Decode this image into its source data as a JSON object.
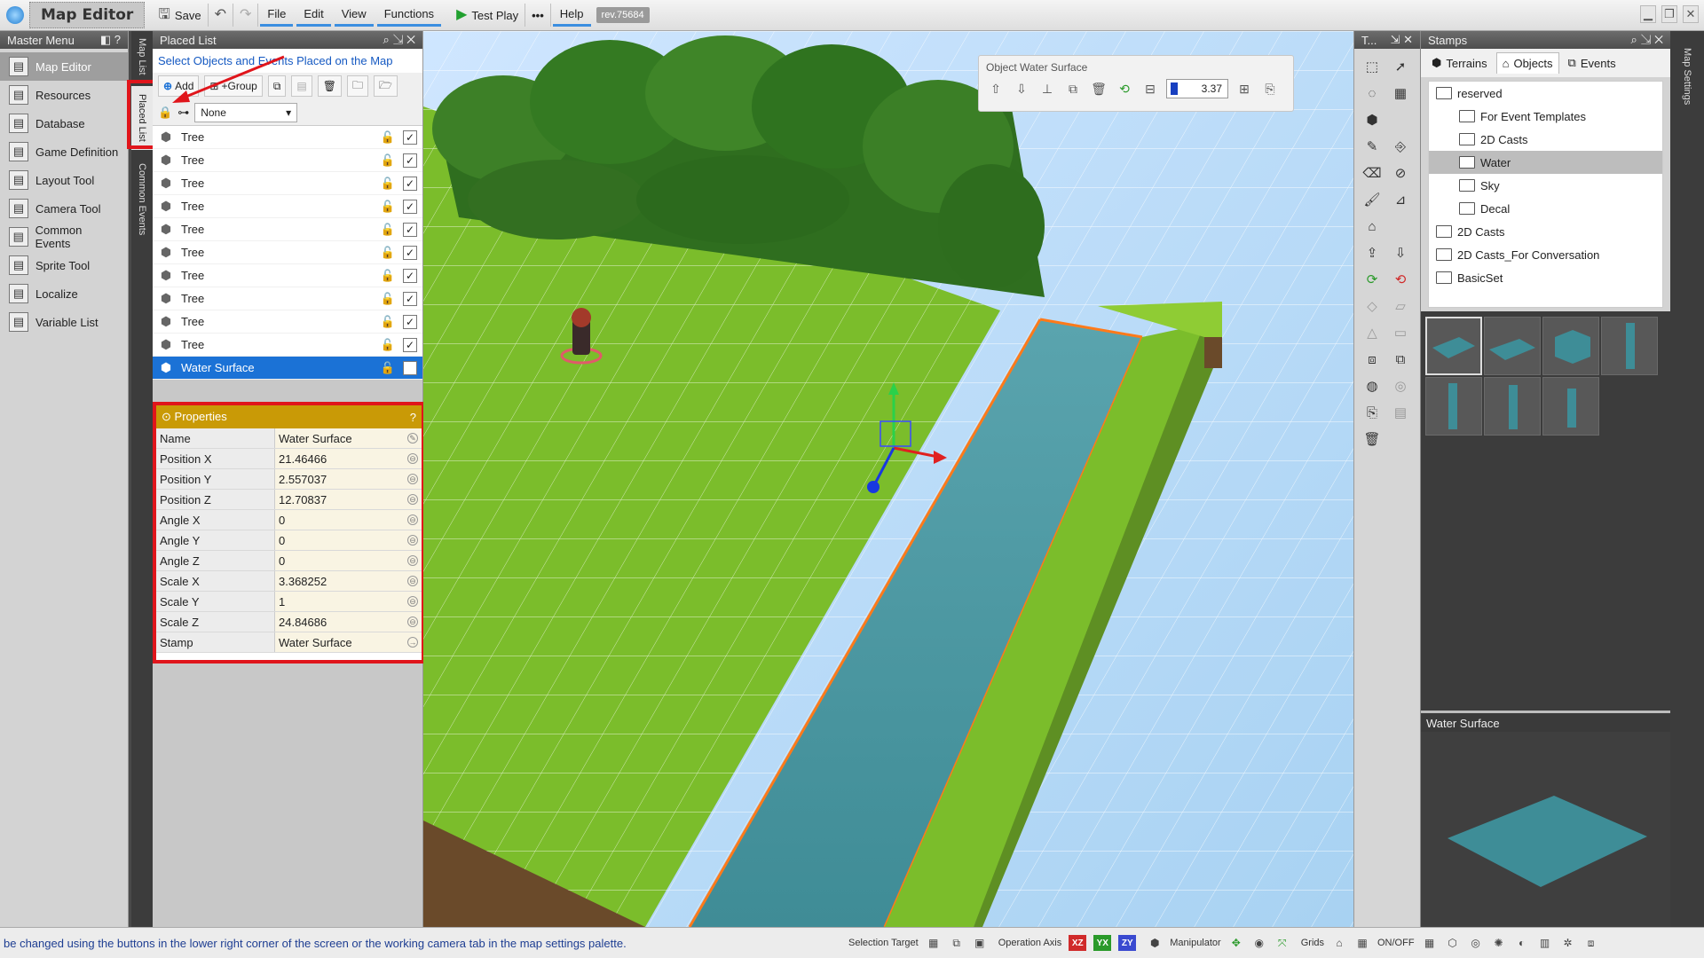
{
  "app": {
    "title": "Map Editor",
    "revision": "rev.75684"
  },
  "toolbar": {
    "save_label": "Save",
    "menus": [
      "File",
      "Edit",
      "View",
      "Functions"
    ],
    "test_play_label": "Test Play",
    "more_label": "•••",
    "help_label": "Help"
  },
  "master_menu": {
    "title": "Master Menu",
    "items": [
      {
        "label": "Map Editor",
        "icon": "map-icon"
      },
      {
        "label": "Resources",
        "icon": "resources-icon"
      },
      {
        "label": "Database",
        "icon": "database-icon"
      },
      {
        "label": "Game Definition",
        "icon": "game-definition-icon"
      },
      {
        "label": "Layout Tool",
        "icon": "layout-icon"
      },
      {
        "label": "Camera Tool",
        "icon": "camera-icon"
      },
      {
        "label": "Common Events",
        "icon": "common-events-icon"
      },
      {
        "label": "Sprite Tool",
        "icon": "sprite-icon"
      },
      {
        "label": "Localize",
        "icon": "localize-icon"
      },
      {
        "label": "Variable List",
        "icon": "variable-icon"
      }
    ]
  },
  "side_tabs": [
    "Map List",
    "Placed List",
    "Common Events"
  ],
  "placed_list": {
    "title": "Placed List",
    "hint": "Select Objects and Events Placed on the Map",
    "add_label": "Add",
    "group_label": "+Group",
    "filter_value": "None",
    "items": [
      {
        "name": "Tree"
      },
      {
        "name": "Tree"
      },
      {
        "name": "Tree"
      },
      {
        "name": "Tree"
      },
      {
        "name": "Tree"
      },
      {
        "name": "Tree"
      },
      {
        "name": "Tree"
      },
      {
        "name": "Tree"
      },
      {
        "name": "Tree"
      },
      {
        "name": "Tree"
      },
      {
        "name": "Water Surface"
      }
    ]
  },
  "properties": {
    "title": "Properties",
    "help": "?",
    "rows": [
      {
        "key": "Name",
        "value": "Water Surface"
      },
      {
        "key": "Position X",
        "value": "21.46466"
      },
      {
        "key": "Position Y",
        "value": "2.557037"
      },
      {
        "key": "Position Z",
        "value": "12.70837"
      },
      {
        "key": "Angle X",
        "value": "0"
      },
      {
        "key": "Angle Y",
        "value": "0"
      },
      {
        "key": "Angle Z",
        "value": "0"
      },
      {
        "key": "Scale X",
        "value": "3.368252"
      },
      {
        "key": "Scale Y",
        "value": "1"
      },
      {
        "key": "Scale Z",
        "value": "24.84686"
      },
      {
        "key": "Stamp",
        "value": "Water Surface"
      }
    ]
  },
  "object_panel": {
    "title": "Object Water Surface",
    "value": "3.37"
  },
  "tools_title": "T...",
  "stamps": {
    "title": "Stamps",
    "tabs": [
      "Terrains",
      "Objects",
      "Events"
    ],
    "tree": [
      {
        "label": "reserved",
        "level": 0
      },
      {
        "label": "For Event Templates",
        "level": 1
      },
      {
        "label": "2D Casts",
        "level": 1
      },
      {
        "label": "Water",
        "level": 1
      },
      {
        "label": "Sky",
        "level": 1
      },
      {
        "label": "Decal",
        "level": 1
      },
      {
        "label": "2D Casts",
        "level": 0
      },
      {
        "label": "2D Casts_For Conversation",
        "level": 0
      },
      {
        "label": "BasicSet",
        "level": 0
      }
    ],
    "preview_title": "Water Surface"
  },
  "map_settings_label": "Map Settings",
  "status": {
    "message": "be changed using the buttons in the lower right corner of the screen or the working camera tab in the map settings palette.",
    "selection_target": "Selection Target",
    "operation_axis": "Operation Axis",
    "axes": [
      "XZ",
      "YX",
      "ZY"
    ],
    "manipulator": "Manipulator",
    "grids": "Grids",
    "onoff": "ON/OFF"
  },
  "colors": {
    "accent": "#1b72d6",
    "highlight": "#e0151b",
    "props_header": "#c99a06",
    "grass": "#7fbf2a",
    "water": "#4a9aa5"
  }
}
